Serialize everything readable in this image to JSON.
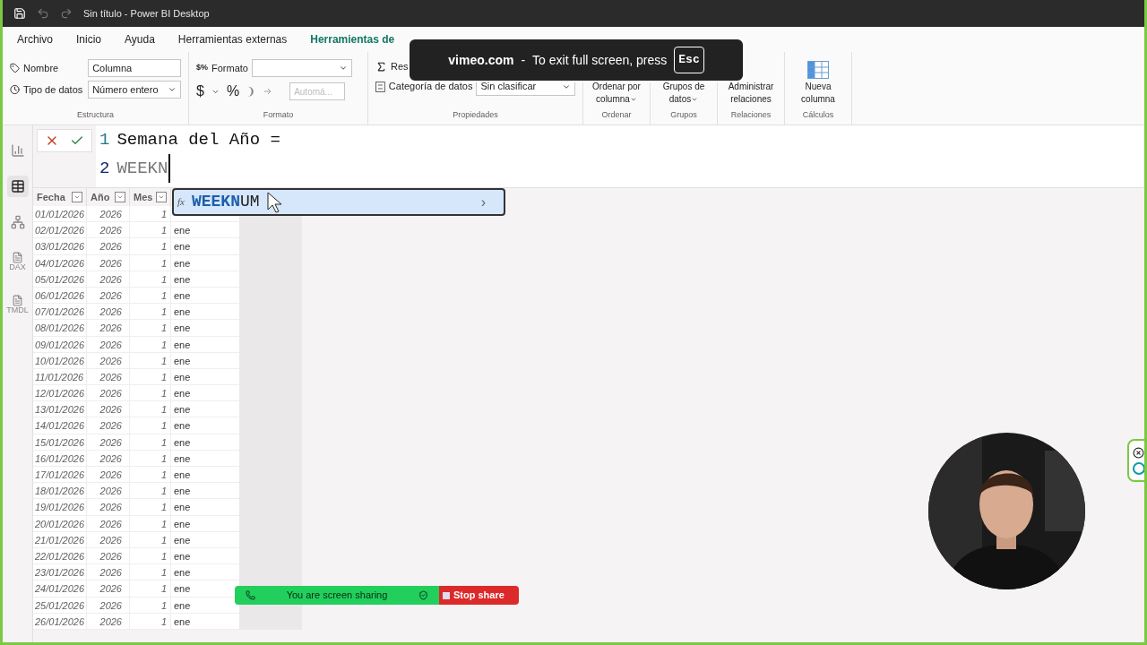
{
  "window": {
    "title": "Sin título - Power BI Desktop"
  },
  "menu_tabs": [
    {
      "label": "Archivo",
      "selected": false
    },
    {
      "label": "Inicio",
      "selected": false
    },
    {
      "label": "Ayuda",
      "selected": false
    },
    {
      "label": "Herramientas externas",
      "selected": false
    },
    {
      "label": "Herramientas de",
      "selected": true
    }
  ],
  "ribbon": {
    "estructura": {
      "name_label": "Nombre",
      "name_value": "Columna",
      "type_label": "Tipo de datos",
      "type_value": "Número entero",
      "group": "Estructura"
    },
    "formato": {
      "format_icon": "$%",
      "format_label": "Formato",
      "currency": "$",
      "percent": "%",
      "comma": "❩",
      "decimals_placeholder": "Automá...",
      "group": "Formato"
    },
    "propiedades": {
      "summary_label": "Res",
      "category_label": "Categoría de datos",
      "category_value": "Sin clasificar",
      "group": "Propiedades"
    },
    "big_buttons": [
      {
        "kind": "sort",
        "lines": [
          "Ordenar por",
          "columna"
        ],
        "dropdown": true,
        "group": "Ordenar"
      },
      {
        "kind": "groups",
        "lines": [
          "Grupos de",
          "datos"
        ],
        "dropdown": true,
        "group": "Grupos"
      },
      {
        "kind": "relations",
        "lines": [
          "Administrar",
          "relaciones"
        ],
        "dropdown": false,
        "group": "Relaciones"
      },
      {
        "kind": "newcolumn",
        "lines": [
          "Nueva",
          "columna"
        ],
        "dropdown": false,
        "group": "Cálculos"
      }
    ]
  },
  "rail": [
    {
      "kind": "report",
      "selected": false
    },
    {
      "kind": "table",
      "selected": true
    },
    {
      "kind": "model",
      "selected": false
    },
    {
      "kind": "file",
      "label": "DAX",
      "selected": false
    },
    {
      "kind": "file",
      "label": "TMDL",
      "selected": false
    }
  ],
  "formula": {
    "lines": [
      {
        "number": "1",
        "text": "Semana del Año ="
      },
      {
        "number": "2",
        "text": "WEEKN"
      }
    ]
  },
  "autocomplete": {
    "icon": "fx",
    "text": "**WEEKN**UM",
    "arrow": "›"
  },
  "table": {
    "columns": [
      "Fecha",
      "Año",
      "Mes"
    ],
    "rows": [
      [
        "01/01/2026",
        "2026",
        "1"
      ],
      [
        "02/01/2026",
        "2026",
        "1",
        "ene"
      ],
      [
        "03/01/2026",
        "2026",
        "1",
        "ene"
      ],
      [
        "04/01/2026",
        "2026",
        "1",
        "ene"
      ],
      [
        "05/01/2026",
        "2026",
        "1",
        "ene"
      ],
      [
        "06/01/2026",
        "2026",
        "1",
        "ene"
      ],
      [
        "07/01/2026",
        "2026",
        "1",
        "ene"
      ],
      [
        "08/01/2026",
        "2026",
        "1",
        "ene"
      ],
      [
        "09/01/2026",
        "2026",
        "1",
        "ene"
      ],
      [
        "10/01/2026",
        "2026",
        "1",
        "ene"
      ],
      [
        "11/01/2026",
        "2026",
        "1",
        "ene"
      ],
      [
        "12/01/2026",
        "2026",
        "1",
        "ene"
      ],
      [
        "13/01/2026",
        "2026",
        "1",
        "ene"
      ],
      [
        "14/01/2026",
        "2026",
        "1",
        "ene"
      ],
      [
        "15/01/2026",
        "2026",
        "1",
        "ene"
      ],
      [
        "16/01/2026",
        "2026",
        "1",
        "ene"
      ],
      [
        "17/01/2026",
        "2026",
        "1",
        "ene"
      ],
      [
        "18/01/2026",
        "2026",
        "1",
        "ene"
      ],
      [
        "19/01/2026",
        "2026",
        "1",
        "ene"
      ],
      [
        "20/01/2026",
        "2026",
        "1",
        "ene"
      ],
      [
        "21/01/2026",
        "2026",
        "1",
        "ene"
      ],
      [
        "22/01/2026",
        "2026",
        "1",
        "ene"
      ],
      [
        "23/01/2026",
        "2026",
        "1",
        "ene"
      ],
      [
        "24/01/2026",
        "2026",
        "1",
        "ene"
      ],
      [
        "25/01/2026",
        "2026",
        "1",
        "ene"
      ],
      [
        "26/01/2026",
        "2026",
        "1",
        "ene"
      ]
    ]
  },
  "fullscreen_toast": {
    "site": "vimeo.com",
    "separator": "-",
    "message": "To exit full screen, press",
    "key": "Esc"
  },
  "share_bar": {
    "message": "You are screen sharing",
    "stop": "Stop share"
  }
}
